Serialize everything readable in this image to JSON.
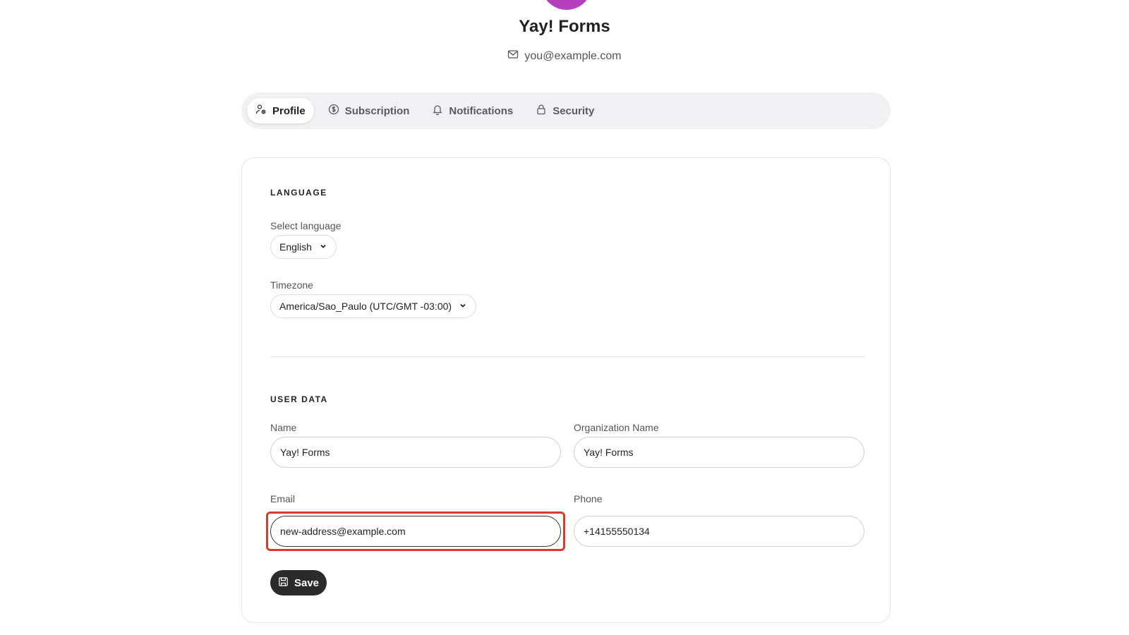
{
  "header": {
    "org_name": "Yay! Forms",
    "email": "you@example.com",
    "avatar_color": "#b43fbf"
  },
  "tabs": [
    {
      "label": "Profile",
      "icon": "user-settings-icon",
      "active": true
    },
    {
      "label": "Subscription",
      "icon": "dollar-circle-icon",
      "active": false
    },
    {
      "label": "Notifications",
      "icon": "bell-icon",
      "active": false
    },
    {
      "label": "Security",
      "icon": "lock-icon",
      "active": false
    }
  ],
  "language_section": {
    "title": "LANGUAGE",
    "language_label": "Select language",
    "language_value": "English",
    "timezone_label": "Timezone",
    "timezone_value": "America/Sao_Paulo (UTC/GMT -03:00)"
  },
  "user_data_section": {
    "title": "USER DATA",
    "name_label": "Name",
    "name_value": "Yay! Forms",
    "org_label": "Organization Name",
    "org_value": "Yay! Forms",
    "email_label": "Email",
    "email_value": "new-address@example.com",
    "phone_label": "Phone",
    "phone_value": "+14155550134",
    "save_label": "Save"
  },
  "colors": {
    "highlight": "#d93a2b",
    "button_bg": "#2b2b2b"
  }
}
